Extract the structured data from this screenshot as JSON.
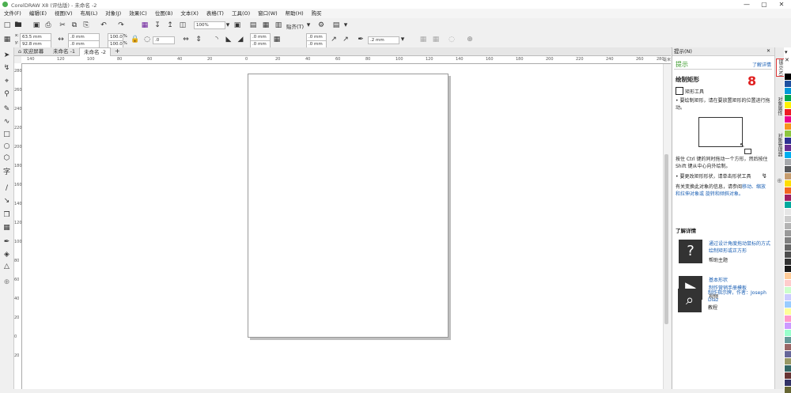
{
  "title": "CorelDRAW X8 (评估版) - 未命名 -2",
  "window_buttons": [
    "—",
    "▢",
    "✕"
  ],
  "menu": [
    "文件(F)",
    "编辑(E)",
    "视图(V)",
    "布局(L)",
    "对象(J)",
    "效果(C)",
    "位图(B)",
    "文本(X)",
    "表格(T)",
    "工具(O)",
    "窗口(W)",
    "帮助(H)",
    "购买"
  ],
  "toolbar": {
    "zoom": "100%",
    "snap_label": "贴齐(T)"
  },
  "props": {
    "x": "63.5 mm",
    "y": "92.8 mm",
    "w": ".0 mm",
    "h": ".0 mm",
    "sx": "100.0",
    "sy": "100.0",
    "pct": "%",
    "angle": ".0",
    "c1": ".0 mm",
    "c2": ".0 mm",
    "c3": ".0 mm",
    "c4": ".0 mm",
    "outline": ".2 mm"
  },
  "tabs": [
    "欢迎屏幕",
    "未命名 -1",
    "未命名 -2"
  ],
  "hruler_ticks": [
    "140",
    "120",
    "100",
    "80",
    "60",
    "40",
    "20",
    "0",
    "20",
    "40",
    "60",
    "80",
    "100",
    "120",
    "140",
    "160",
    "180",
    "200",
    "220",
    "240",
    "260",
    "280"
  ],
  "hruler_unit": "毫米",
  "vruler_ticks": [
    "280",
    "260",
    "240",
    "220",
    "200",
    "180",
    "160",
    "140",
    "120",
    "100",
    "80",
    "60",
    "40",
    "20",
    "0",
    "20"
  ],
  "docker": {
    "header": "提示(N)",
    "tab_title": "提示",
    "learn_more": "了解详情",
    "heading": "绘制矩形",
    "step_number": "8",
    "tool_name": "矩形工具",
    "p1": "• 要绘制矩形，请在要放置矩形的位置进行拖动。",
    "p2": "按住 Ctrl 键的同时拖动一个方形，然后按住 Shift 键从中心向外绘制。",
    "p3": "• 要更改矩形形状，请单击形状工具",
    "p4_a": "有关变换此对象的信息，请参阅",
    "p4_links": "移动、缩放和拉伸对象或 旋转和倾斜对象。",
    "section": "了解详情",
    "items": [
      {
        "icon": "?",
        "title": "通过设计角度拖动鼠标的方式绘制矩形或正方形",
        "type": "帮助主题"
      },
      {
        "icon": "▶",
        "title": "基本形状",
        "sub": "制作营销手册模板",
        "type": "视频"
      },
      {
        "icon": "⌕",
        "title": "制作指示牌，作者：Joseph Diaz",
        "type": "教程"
      }
    ]
  },
  "side_tabs": [
    "提示(N)",
    "对象属性",
    "对象管理器"
  ],
  "palette_colors": [
    "#ffffff",
    "#000000",
    "#1e50a0",
    "#0099d8",
    "#00a650",
    "#fff200",
    "#ed1c24",
    "#ec008c",
    "#f7941d",
    "#8dc63f",
    "#2e3192",
    "#662d91",
    "#00aeef",
    "#a7a9ac",
    "#58595b",
    "#c69c6d",
    "#ffde00",
    "#f26522",
    "#9e1f63",
    "#00a99d",
    "#e6e6e6",
    "#cccccc",
    "#b3b3b3",
    "#999999",
    "#808080",
    "#666666",
    "#4d4d4d",
    "#333333",
    "#1a1a1a",
    "#ffcc99",
    "#ffcccc",
    "#ccffcc",
    "#ccccff",
    "#99ccff",
    "#ffff99",
    "#ff99cc",
    "#cc99ff",
    "#99ffcc",
    "#669999",
    "#996666",
    "#666699",
    "#999966",
    "#336666",
    "#663333",
    "#333366",
    "#666633"
  ]
}
